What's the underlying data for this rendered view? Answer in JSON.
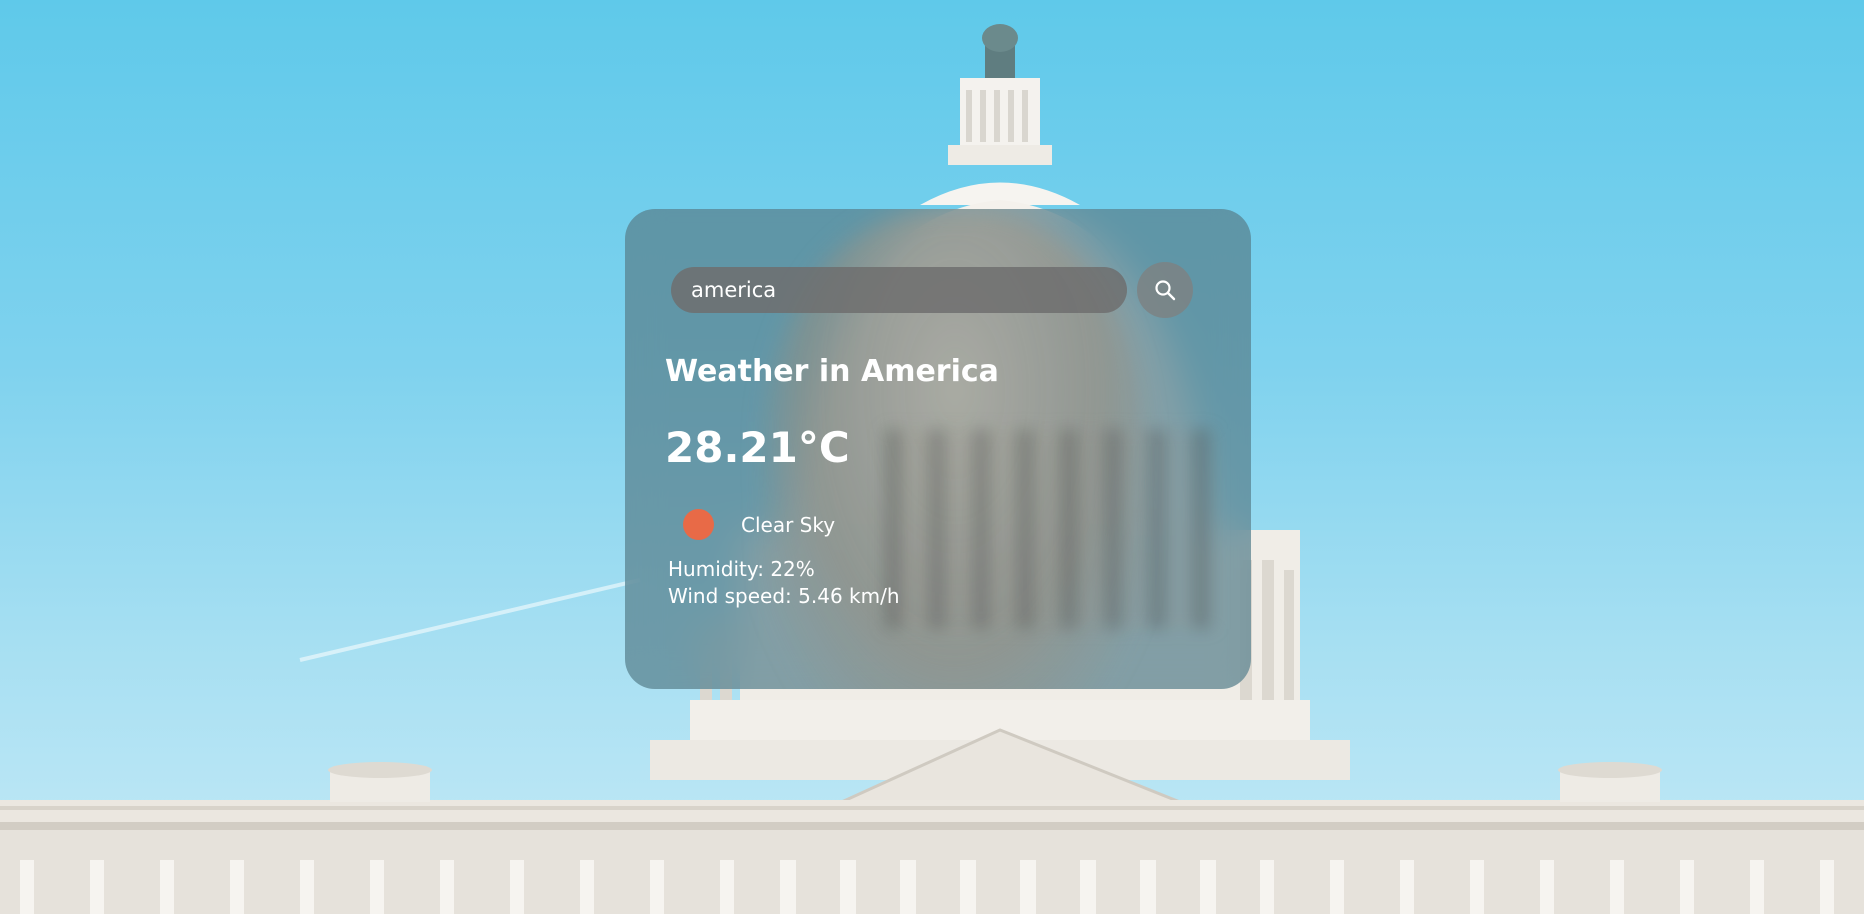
{
  "search": {
    "value": "america",
    "placeholder": "Search"
  },
  "weather": {
    "title": "Weather in America",
    "temperature": "28.21°C",
    "description": "Clear Sky",
    "humidity": "Humidity: 22%",
    "wind": "Wind speed: 5.46 km/h"
  },
  "icons": {
    "search": "search-icon",
    "weather": "sun-icon"
  },
  "colors": {
    "sky_top": "#5fc9ea",
    "sun": "#e86a47",
    "card": "#58808c"
  }
}
